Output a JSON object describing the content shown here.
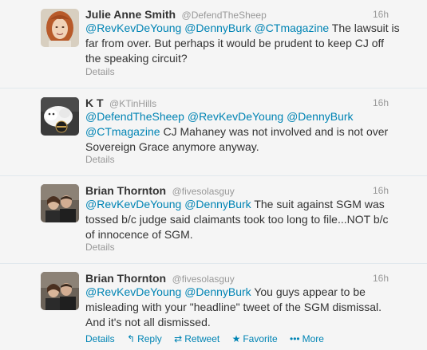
{
  "tweets": [
    {
      "fullname": "Julie Anne Smith",
      "username": "@DefendTheSheep",
      "time": "16h",
      "text": [
        {
          "type": "mention",
          "value": "@RevKevDeYoung"
        },
        {
          "type": "text",
          "value": " "
        },
        {
          "type": "mention",
          "value": "@DennyBurk"
        },
        {
          "type": "text",
          "value": " "
        },
        {
          "type": "mention",
          "value": "@CTmagazine"
        },
        {
          "type": "text",
          "value": " The lawsuit is far from over. But perhaps it would be prudent to keep CJ off the speaking circuit?"
        }
      ],
      "details_label": "Details"
    },
    {
      "fullname": "K T",
      "username": "@KTinHills",
      "time": "16h",
      "text": [
        {
          "type": "mention",
          "value": "@DefendTheSheep"
        },
        {
          "type": "text",
          "value": " "
        },
        {
          "type": "mention",
          "value": "@RevKevDeYoung"
        },
        {
          "type": "text",
          "value": " "
        },
        {
          "type": "mention",
          "value": "@DennyBurk"
        },
        {
          "type": "text",
          "value": " "
        },
        {
          "type": "mention",
          "value": "@CTmagazine"
        },
        {
          "type": "text",
          "value": " CJ Mahaney was not involved and is not over Sovereign Grace anymore anyway."
        }
      ],
      "details_label": "Details"
    },
    {
      "fullname": "Brian Thornton",
      "username": "@fivesolasguy",
      "time": "16h",
      "text": [
        {
          "type": "mention",
          "value": "@RevKevDeYoung"
        },
        {
          "type": "text",
          "value": " "
        },
        {
          "type": "mention",
          "value": "@DennyBurk"
        },
        {
          "type": "text",
          "value": " The suit against SGM was tossed b/c judge said claimants took too long to file...NOT b/c of innocence of SGM."
        }
      ],
      "details_label": "Details"
    },
    {
      "fullname": "Brian Thornton",
      "username": "@fivesolasguy",
      "time": "16h",
      "text": [
        {
          "type": "mention",
          "value": "@RevKevDeYoung"
        },
        {
          "type": "text",
          "value": " "
        },
        {
          "type": "mention",
          "value": "@DennyBurk"
        },
        {
          "type": "text",
          "value": " You guys appear to be misleading with your \"headline\" tweet of the SGM dismissal. And it's not all dismissed."
        }
      ],
      "details_label": "Details",
      "actions": {
        "reply_label": "Reply",
        "retweet_label": "Retweet",
        "favorite_label": "Favorite",
        "more_label": "More",
        "reply_icon": "reply-arrow-icon",
        "retweet_icon": "retweet-icon",
        "favorite_icon": "star-icon",
        "more_icon": "dots-icon"
      }
    }
  ],
  "colors": {
    "link": "#0084b4",
    "muted": "#999999",
    "text": "#333333",
    "background": "#f5f5f5"
  }
}
